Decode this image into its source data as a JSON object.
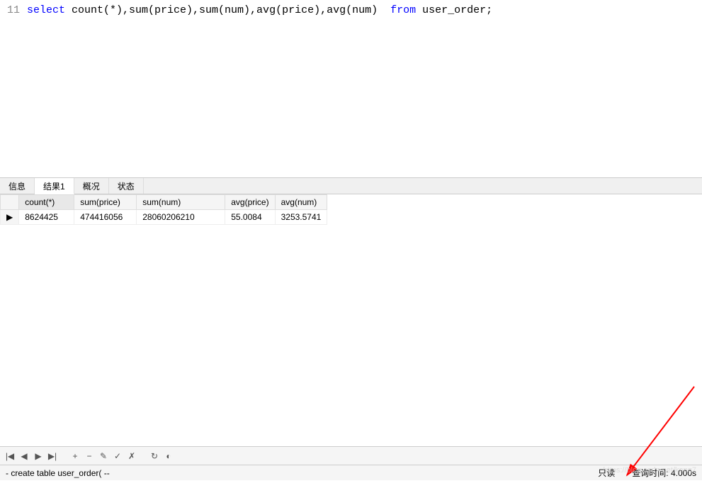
{
  "editor": {
    "line_number": "11",
    "kw_select": "select",
    "code_mid": " count(*),sum(price),sum(num),avg(price),avg(num)  ",
    "kw_from": "from",
    "code_end": " user_order;"
  },
  "tabs": {
    "info": "信息",
    "result1": "结果1",
    "profile": "概况",
    "status": "状态"
  },
  "result": {
    "headers": {
      "count": "count(*)",
      "sum_price": "sum(price)",
      "sum_num": "sum(num)",
      "avg_price": "avg(price)",
      "avg_num": "avg(num)"
    },
    "row0": {
      "count": "8624425",
      "sum_price": "474416056",
      "sum_num": "28060206210",
      "avg_price": "55.0084",
      "avg_num": "3253.5741"
    },
    "row_marker": "▶"
  },
  "toolbar": {
    "first": "|◀",
    "prev": "◀",
    "next": "▶",
    "last": "▶|",
    "add": "+",
    "delete": "−",
    "edit": "✎",
    "confirm": "✓",
    "cancel": "✗",
    "refresh": "↻",
    "stop": "◐"
  },
  "status": {
    "left": "- create table user_order( --",
    "readonly": "只读",
    "query_time": "查询时间: 4.000s"
  },
  "watermark": "https://blog.csdn.net/kang7"
}
